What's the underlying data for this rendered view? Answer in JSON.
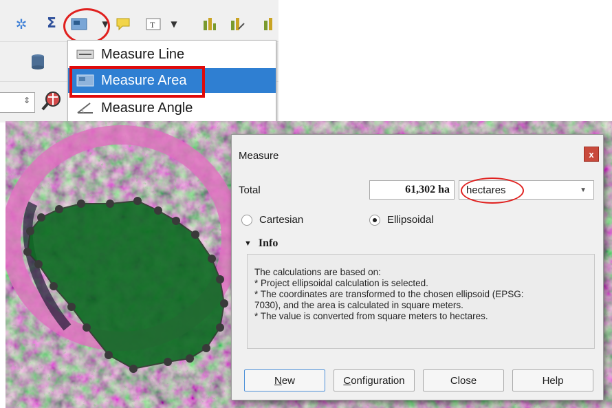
{
  "dropdown": {
    "items": [
      {
        "label": "Measure Line",
        "icon": "measure-line-icon"
      },
      {
        "label": "Measure Area",
        "icon": "measure-area-icon"
      },
      {
        "label": "Measure Angle",
        "icon": "measure-angle-icon"
      }
    ],
    "selected_index": 1
  },
  "measure_dialog": {
    "title": "Measure",
    "close_glyph": "x",
    "total_label": "Total",
    "total_value": "61,302 ha",
    "unit": "hectares",
    "radio_cartesian": "Cartesian",
    "radio_ellipsoidal": "Ellipsoidal",
    "selected_mode": "Ellipsoidal",
    "info_header": "Info",
    "info_lines": [
      "The calculations are based on:",
      "* Project ellipsoidal calculation is selected.",
      "* The coordinates are transformed to the chosen ellipsoid (EPSG:",
      "7030), and the area is calculated in square meters.",
      "* The value is converted from square meters to hectares."
    ],
    "buttons": {
      "new_underline": "N",
      "new_rest": "ew",
      "config_underline": "C",
      "config_rest": "onfiguration",
      "close": "Close",
      "help": "Help"
    }
  },
  "colors": {
    "highlight": "#2f7fd2",
    "annotation_red": "#e00a0a",
    "polygon_fill": "#0d6a22",
    "vertex": "#3a3a3a"
  }
}
